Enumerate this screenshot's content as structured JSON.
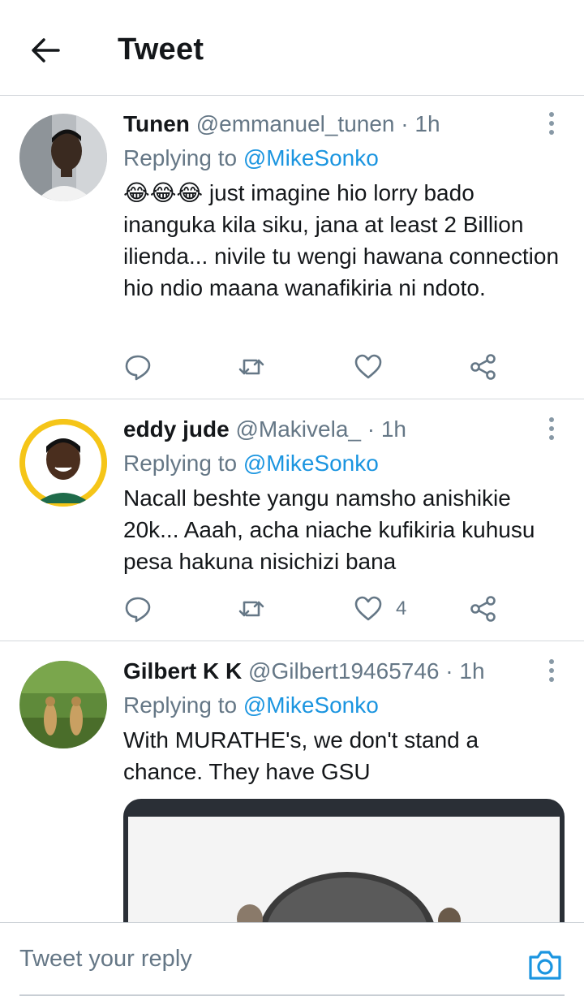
{
  "header": {
    "title": "Tweet",
    "back_icon": "arrow-left-icon"
  },
  "colors": {
    "link": "#1b95e0",
    "muted": "#657786",
    "text": "#14171a",
    "divider": "#d4d8dc"
  },
  "tweets": [
    {
      "name": "Tunen",
      "handle": "@emmanuel_tunen",
      "time": "· 1h",
      "replying_prefix": "Replying to",
      "replying_mention": "@MikeSonko",
      "text": "😂😂😂 just imagine hio lorry bado inanguka kila siku, jana at least 2 Billion ilienda... nivile tu wengi hawana connection hio ndio maana wanafikiria ni ndoto.",
      "likes": ""
    },
    {
      "name": "eddy jude",
      "handle": "@Makivela_",
      "time": "· 1h",
      "replying_prefix": "Replying to",
      "replying_mention": "@MikeSonko",
      "text": "Nacall beshte yangu namsho anishikie 20k... Aaah, acha niache kufikiria kuhusu pesa hakuna nisichizi bana",
      "likes": "4"
    },
    {
      "name": "Gilbert K K",
      "handle": "@Gilbert19465746",
      "time": "· 1h",
      "replying_prefix": "Replying to",
      "replying_mention": "@MikeSonko",
      "text": "With MURATHE's, we don't stand a chance. They have GSU",
      "likes": ""
    }
  ],
  "reply_bar": {
    "placeholder": "Tweet your reply",
    "camera_icon": "camera-icon"
  }
}
